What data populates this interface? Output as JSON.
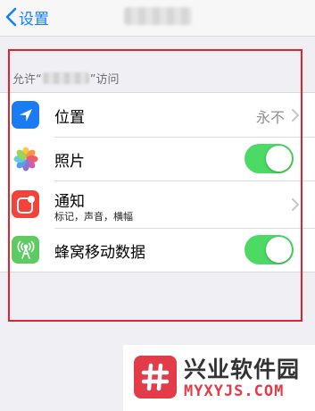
{
  "nav": {
    "back_label": "设置"
  },
  "section": {
    "prefix": "允许“",
    "suffix": "”访问"
  },
  "rows": [
    {
      "label": "位置",
      "value": "永不",
      "icon": "location-arrow-icon",
      "icon_color": "#1a7cf5"
    },
    {
      "label": "照片",
      "toggle": true,
      "icon": "photos-flower-icon"
    },
    {
      "label": "通知",
      "sublabel": "标记，声音，横幅",
      "icon": "notifications-icon",
      "icon_color": "#f2423a"
    },
    {
      "label": "蜂窝移动数据",
      "toggle": true,
      "icon": "cellular-antenna-icon",
      "icon_color": "#5ecb62"
    }
  ],
  "watermark": {
    "title": "兴业软件园",
    "url": "MYXYJS.COM"
  },
  "colors": {
    "accent": "#157efb",
    "toggle_on": "#4cd964",
    "highlight": "#e2232b",
    "watermark": "#e23c49"
  }
}
